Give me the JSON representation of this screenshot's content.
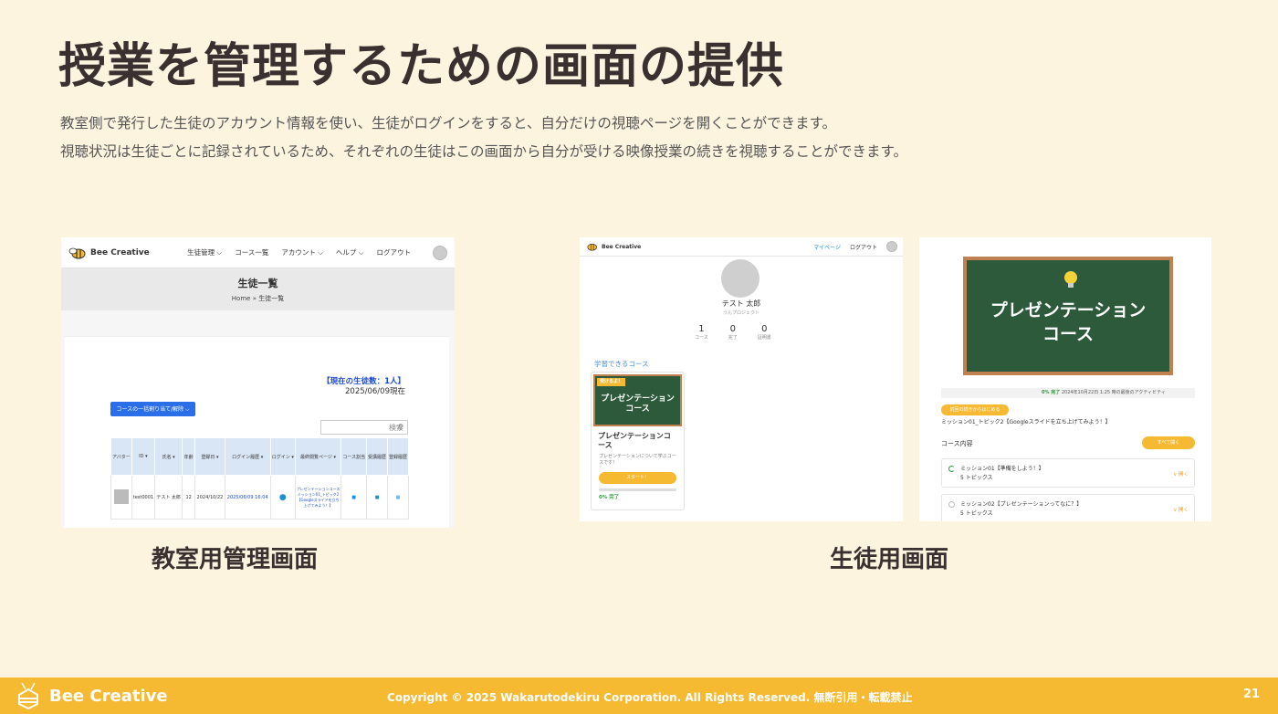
{
  "page": {
    "title": "授業を管理するための画面の提供",
    "desc1": "教室側で発行した生徒のアカウント情報を使い、生徒がログインをすると、自分だけの視聴ページを開くことができます。",
    "desc2": "視聴状況は生徒ごとに記録されているため、それぞれの生徒はこの画面から自分が受ける映像授業の続きを視聴することができます。",
    "caption_admin": "教室用管理画面",
    "caption_student": "生徒用画面"
  },
  "admin": {
    "logo": "Bee Creative",
    "nav": [
      "生徒管理 ⌵",
      "コース一覧",
      "アカウント ⌵",
      "ヘルプ ⌵",
      "ログアウト"
    ],
    "heading": "生徒一覧",
    "breadcrumb": "Home » 生徒一覧",
    "count": "【現在の生徒数：1人】",
    "date": "2025/06/09現在",
    "assign_button": "コースの一括割り当て/解除 ⌵",
    "search_placeholder": "検索",
    "headers": [
      "アバター",
      "ID ▾",
      "氏名 ▾",
      "年齢",
      "登録日 ▾",
      "ログイン履歴 ▾",
      "ログイン ▾",
      "最終閲覧ページ ▾",
      "コース割当",
      "受講履歴",
      "登録履歴"
    ],
    "row": {
      "id": "test0001",
      "name": "テスト 太郎",
      "age": "12",
      "registered": "2024/10/22",
      "login_history": "2025/06/09 16:04",
      "last_page": "プレゼンテーションコース ミッション01_トピック2【Googleスライドを立ち上げてみよう！】"
    }
  },
  "student1": {
    "logo": "Bee Creative",
    "nav": [
      "マイページ",
      "ログアウト"
    ],
    "name": "テスト 太郎",
    "sub": "うんプロジェクト",
    "stats": [
      {
        "n": "1",
        "l": "コース"
      },
      {
        "n": "0",
        "l": "完了"
      },
      {
        "n": "0",
        "l": "証明書"
      }
    ],
    "learnable": "学習できるコース",
    "course_tag": "受けるよ！",
    "course_image_text": "プレゼンテーション\nコース",
    "course_title": "プレゼンテーションコース",
    "course_desc": "プレゼンテーションについて学ぶコースです！",
    "start_button": "スタート！",
    "percent": "0% 完了"
  },
  "student2": {
    "board_text": "プレゼンテーション\nコース",
    "activity_pct": "0% 完了",
    "activity_text": "2024年10月22日 1:25 時の最後のアクティビティ",
    "resume_button": "前回の続きからはじめる",
    "mission_line": "ミッション01_トピック2【Googleスライドを立ち上げてみよう！】",
    "contents": "コース内容",
    "expand_all": "すべて開く",
    "missions": [
      {
        "title": "ミッション01【準備をしよう！】",
        "topics": "5 トピックス",
        "open": "∨ 開く"
      },
      {
        "title": "ミッション02【プレゼンテーションってなに？】",
        "topics": "5 トピックス",
        "open": "∨ 開く"
      }
    ]
  },
  "footer": {
    "logo": "Bee Creative",
    "copyright": "Copyright © 2025 Wakarutodekiru Corporation. All Rights Reserved. 無断引用・転載禁止",
    "page": "21"
  },
  "colors": {
    "background": "#fdf4e0",
    "accent": "#f6b932",
    "link": "#1a4bd6",
    "board": "#2e5a3c"
  }
}
